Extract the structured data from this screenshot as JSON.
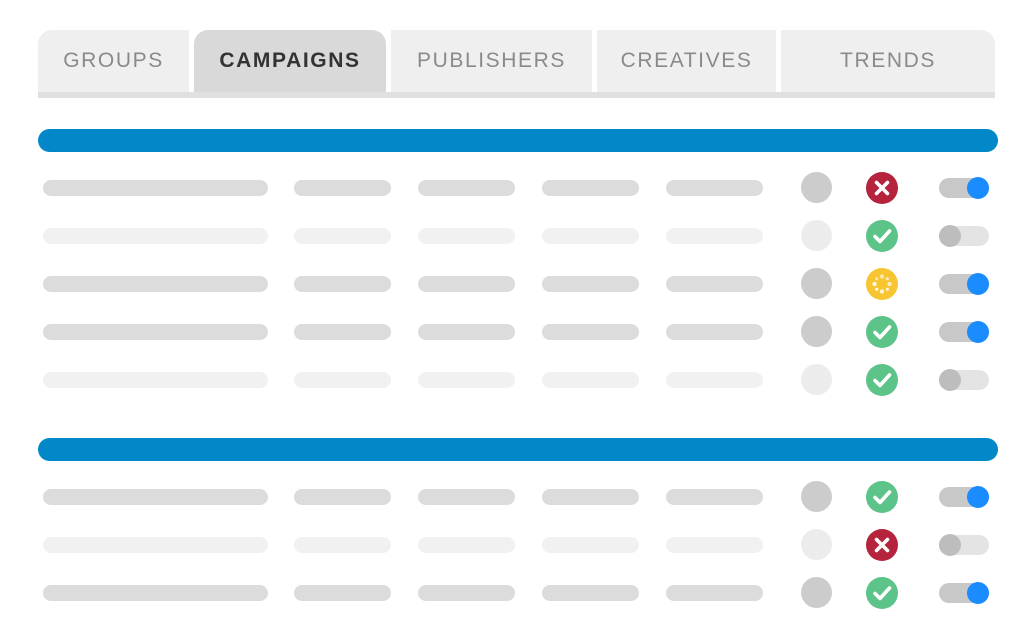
{
  "tabs": [
    {
      "label": "GROUPS",
      "active": false
    },
    {
      "label": "CAMPAIGNS",
      "active": true
    },
    {
      "label": "PUBLISHERS",
      "active": false
    },
    {
      "label": "CREATIVES",
      "active": false
    },
    {
      "label": "TRENDS",
      "active": false
    }
  ],
  "colors": {
    "section_header": "#0288c8",
    "skeleton_dark": "#dcdcdc",
    "skeleton_light": "#f1f1f1",
    "dot_dark": "#cccccc",
    "dot_light": "#ececec",
    "toggle_track_on": "#c8c8c8",
    "toggle_track_off": "#e4e4e4",
    "toggle_knob_on": "#1a8cff",
    "toggle_knob_off": "#bdbdbd",
    "status_error": "#b5243c",
    "status_ok": "#5cc389",
    "status_pending": "#f7c531"
  },
  "sections": [
    {
      "rows": [
        {
          "emphasis": "dark",
          "status": "error",
          "toggle_on": true
        },
        {
          "emphasis": "light",
          "status": "ok",
          "toggle_on": false
        },
        {
          "emphasis": "dark",
          "status": "pending",
          "toggle_on": true
        },
        {
          "emphasis": "dark",
          "status": "ok",
          "toggle_on": true
        },
        {
          "emphasis": "light",
          "status": "ok",
          "toggle_on": false
        }
      ]
    },
    {
      "rows": [
        {
          "emphasis": "dark",
          "status": "ok",
          "toggle_on": true
        },
        {
          "emphasis": "light",
          "status": "error",
          "toggle_on": false
        },
        {
          "emphasis": "dark",
          "status": "ok",
          "toggle_on": true
        }
      ]
    }
  ],
  "icons": {
    "error": "x-circle-icon",
    "ok": "check-circle-icon",
    "pending": "loading-spinner-icon"
  }
}
